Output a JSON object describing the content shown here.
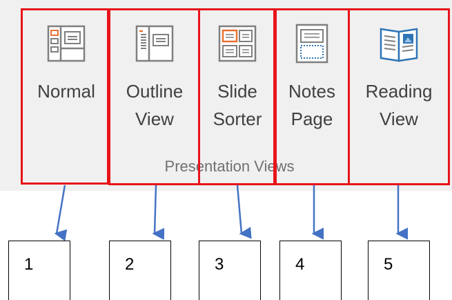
{
  "ribbon_group": {
    "label": "Presentation Views",
    "buttons": [
      {
        "name": "normal",
        "label_lines": [
          "Normal",
          ""
        ],
        "icon": "normal-view-icon"
      },
      {
        "name": "outline-view",
        "label_lines": [
          "Outline",
          "View"
        ],
        "icon": "outline-view-icon"
      },
      {
        "name": "slide-sorter",
        "label_lines": [
          "Slide",
          "Sorter"
        ],
        "icon": "slide-sorter-icon"
      },
      {
        "name": "notes-page",
        "label_lines": [
          "Notes",
          "Page"
        ],
        "icon": "notes-page-icon"
      },
      {
        "name": "reading-view",
        "label_lines": [
          "Reading",
          "View"
        ],
        "icon": "reading-view-icon"
      }
    ]
  },
  "callouts": [
    "1",
    "2",
    "3",
    "4",
    "5"
  ],
  "colors": {
    "highlight_border": "#e8131a",
    "arrow": "#4472c4",
    "icon_accent": "#e97132",
    "icon_blue": "#2e75b6",
    "ribbon_bg": "#f0f0f0"
  }
}
